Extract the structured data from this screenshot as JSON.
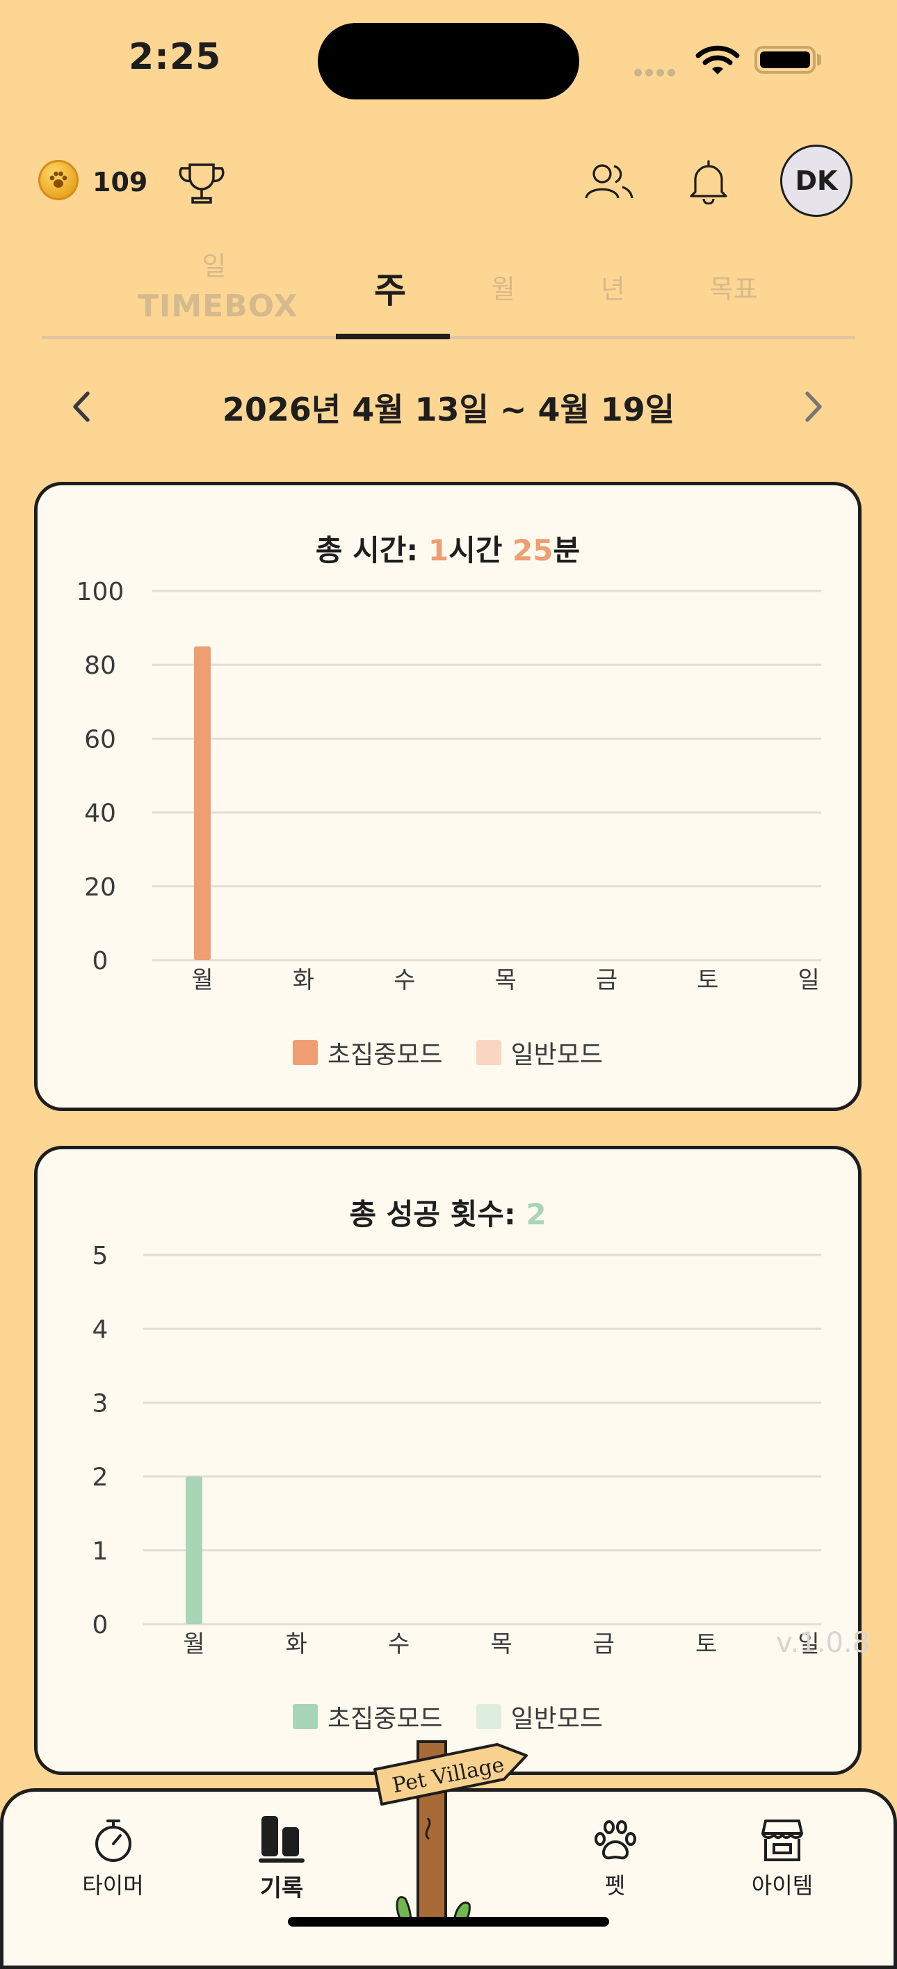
{
  "status_bar": {
    "time": "2:25"
  },
  "header": {
    "coin_count": "109",
    "avatar_initials": "DK"
  },
  "tabs": {
    "day_label": "일",
    "day_sublabel": "TIMEBOX",
    "week": "주",
    "month": "월",
    "year": "년",
    "goal": "목표",
    "selected": "주"
  },
  "date_range": "2026년 4월 13일 ~ 4월 19일",
  "time_card": {
    "title_prefix": "총 시간: ",
    "hours": "1",
    "hours_unit": "시간 ",
    "minutes": "25",
    "minutes_unit": "분",
    "legend": [
      "초집중모드",
      "일반모드"
    ]
  },
  "success_card": {
    "title_prefix": "총 성공 횟수: ",
    "count": "2",
    "legend": [
      "초집중모드",
      "일반모드"
    ]
  },
  "chart_data": [
    {
      "type": "bar",
      "categories": [
        "월",
        "화",
        "수",
        "목",
        "금",
        "토",
        "일"
      ],
      "series": [
        {
          "name": "초집중모드",
          "values": [
            85,
            0,
            0,
            0,
            0,
            0,
            0
          ],
          "color": "#EE9E70"
        },
        {
          "name": "일반모드",
          "values": [
            0,
            0,
            0,
            0,
            0,
            0,
            0
          ],
          "color": "#FAD6C0"
        }
      ],
      "yticks": [
        0,
        20,
        40,
        60,
        80,
        100
      ],
      "ylim": [
        0,
        100
      ],
      "grid": true,
      "legend_position": "bottom"
    },
    {
      "type": "bar",
      "categories": [
        "월",
        "화",
        "수",
        "목",
        "금",
        "토",
        "일"
      ],
      "series": [
        {
          "name": "초집중모드",
          "values": [
            2,
            0,
            0,
            0,
            0,
            0,
            0
          ],
          "color": "#A8D4B8"
        },
        {
          "name": "일반모드",
          "values": [
            0,
            0,
            0,
            0,
            0,
            0,
            0
          ],
          "color": "#DDEEDF"
        }
      ],
      "yticks": [
        0,
        1,
        2,
        3,
        4,
        5
      ],
      "ylim": [
        0,
        5
      ],
      "grid": true,
      "legend_position": "bottom"
    }
  ],
  "version": "v.1.0.8",
  "bottom_nav": {
    "timer": "타이머",
    "record": "기록",
    "pet": "펫",
    "items": "아이템",
    "signpost": "Pet Village"
  },
  "icons": [
    "coin-paw-icon",
    "trophy-icon",
    "friends-icon",
    "bell-icon",
    "wifi-icon",
    "battery-icon",
    "chevron-left-icon",
    "chevron-right-icon",
    "stopwatch-icon",
    "bar-chart-icon",
    "paw-icon",
    "store-icon"
  ]
}
